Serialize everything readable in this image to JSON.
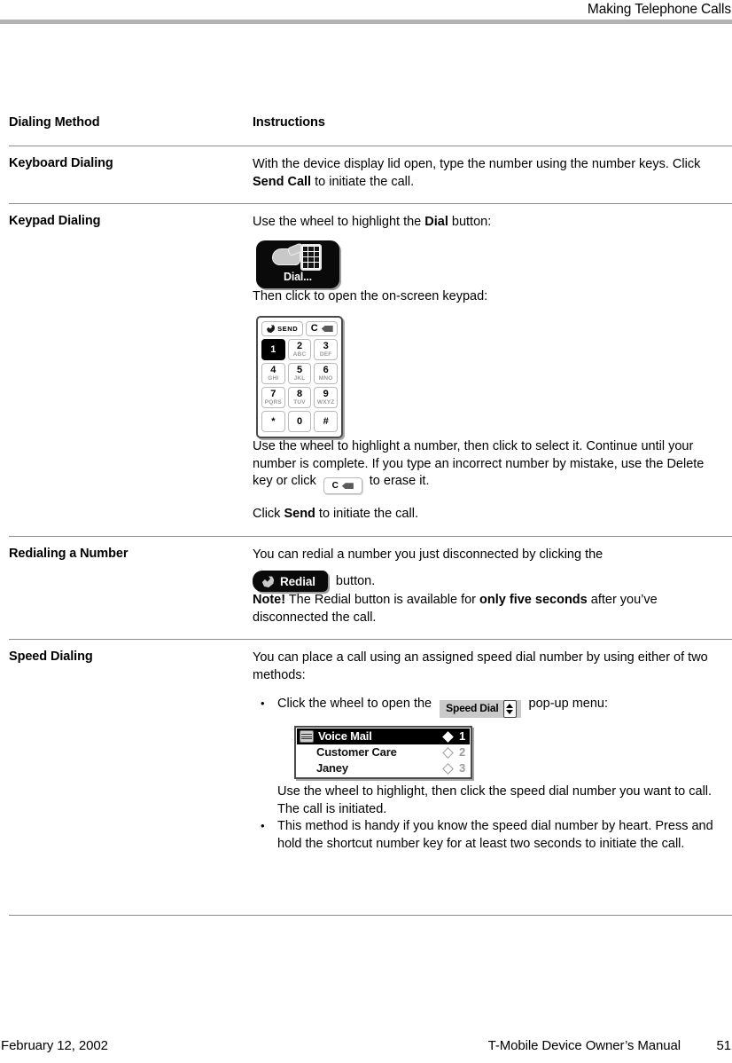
{
  "header": {
    "running_title": "Making Telephone Calls"
  },
  "table": {
    "columns": [
      "Dialing Method",
      "Instructions"
    ],
    "rows": [
      {
        "method": "Keyboard Dialing",
        "instructions_1_a": "With the device display lid open, type the number using the number keys. Click ",
        "instructions_1_b": "Send Call",
        "instructions_1_c": " to initiate the call."
      },
      {
        "method": "Keypad Dialing",
        "p1_a": "Use the wheel to highlight the ",
        "p1_b": "Dial",
        "p1_c": " button:",
        "dial_icon_label": "Dial...",
        "p2": "Then click to open the on-screen keypad:",
        "p3_a": "Use the wheel to highlight a number, then click to select it. Continue until your number is complete. If you type an incorrect number by mistake, use the Delete key or click ",
        "p3_b": " to erase it.",
        "p4_a": "Click ",
        "p4_b": "Send",
        "p4_c": " to initiate the call."
      },
      {
        "method": "Redialing a Number",
        "p1": "You can redial a number you just disconnected by clicking the",
        "redial_button_label": "Redial",
        "p2": " button.",
        "note_label": "Note!",
        "note_a": " The Redial button is available for ",
        "note_b": "only five seconds",
        "note_c": " after you’ve disconnected the call."
      },
      {
        "method": "Speed Dialing",
        "p1": "You can place a call using an assigned speed dial number by using either of two methods:",
        "bullet1_a": "Click the wheel to open the ",
        "speed_dial_label": "Speed Dial",
        "bullet1_b": " pop-up menu:",
        "bullet1_after": "Use the wheel to highlight, then click the speed dial number you want to call. The call is initiated.",
        "bullet2": "This method is handy if you know the speed dial number by heart. Press and hold the shortcut number key for at least two seconds to initiate the call."
      }
    ]
  },
  "keypad": {
    "send_label": "SEND",
    "clear_label": "C",
    "keys": [
      {
        "digit": "1",
        "letters": "",
        "selected": true
      },
      {
        "digit": "2",
        "letters": "ABC",
        "selected": false
      },
      {
        "digit": "3",
        "letters": "DEF",
        "selected": false
      },
      {
        "digit": "4",
        "letters": "GHI",
        "selected": false
      },
      {
        "digit": "5",
        "letters": "JKL",
        "selected": false
      },
      {
        "digit": "6",
        "letters": "MNO",
        "selected": false
      },
      {
        "digit": "7",
        "letters": "PQRS",
        "selected": false
      },
      {
        "digit": "8",
        "letters": "TUV",
        "selected": false
      },
      {
        "digit": "9",
        "letters": "WXYZ",
        "selected": false
      },
      {
        "digit": "*",
        "letters": "",
        "selected": false
      },
      {
        "digit": "0",
        "letters": "",
        "selected": false
      },
      {
        "digit": "#",
        "letters": "",
        "selected": false
      }
    ]
  },
  "speed_dial_popup": {
    "items": [
      {
        "name": "Voice Mail",
        "number": "1",
        "selected": true
      },
      {
        "name": "Customer Care",
        "number": "2",
        "selected": false
      },
      {
        "name": "Janey",
        "number": "3",
        "selected": false
      }
    ]
  },
  "footer": {
    "date": "February 12, 2002",
    "manual": "T-Mobile Device Owner’s Manual",
    "page_number": "51"
  },
  "colors": {
    "rule": "#b3b3b3",
    "table_border": "#8c8c8c",
    "icon_black": "#0a0a0a",
    "control_gray": "#c9c9c9"
  }
}
